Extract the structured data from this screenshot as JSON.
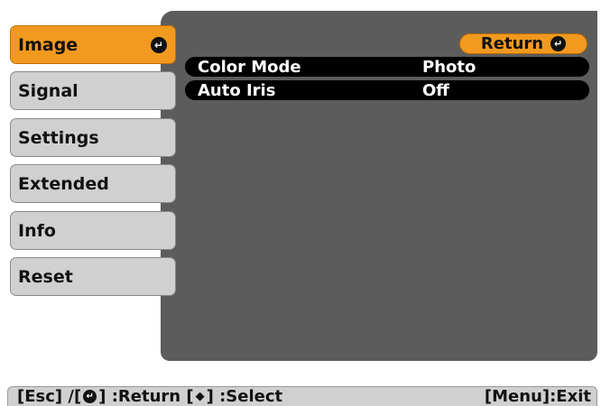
{
  "menu": {
    "items": [
      {
        "label": "Image",
        "active": true
      },
      {
        "label": "Signal"
      },
      {
        "label": "Settings"
      },
      {
        "label": "Extended"
      },
      {
        "label": "Info"
      },
      {
        "label": "Reset"
      }
    ],
    "enter_icon": "enter-icon"
  },
  "panel": {
    "return_label": "Return",
    "rows": [
      {
        "name": "Color Mode",
        "value": "Photo"
      },
      {
        "name": "Auto Iris",
        "value": "Off"
      }
    ]
  },
  "help": {
    "esc": "[Esc] /[",
    "return_text": "] :Return  [",
    "select_text": "] :Select",
    "exit": "[Menu]:Exit"
  },
  "colors": {
    "accent": "#f29a1f",
    "panel": "#5c5c5c",
    "menu_item": "#d0d0d0"
  }
}
